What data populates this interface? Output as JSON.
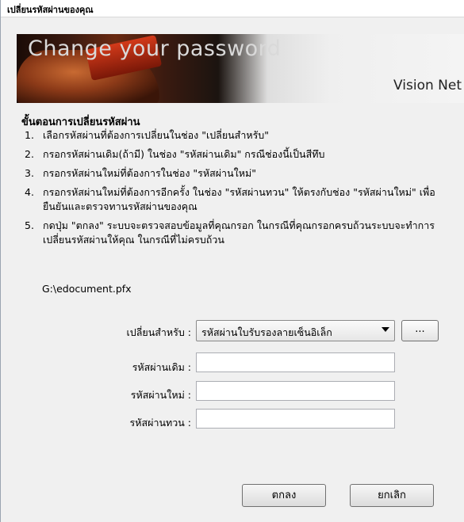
{
  "window": {
    "title": "เปลี่ยนรหัสผ่านของคุณ"
  },
  "banner": {
    "title": "Change your password",
    "logo": "Vision Net"
  },
  "instructions": {
    "heading": "ขั้นตอนการเปลี่ยนรหัสผ่าน",
    "steps": [
      {
        "num": "1.",
        "text": "เลือกรหัสผ่านที่ต้องการเปลี่ยนในช่อง \"เปลี่ยนสำหรับ\""
      },
      {
        "num": "2.",
        "text": "กรอกรหัสผ่านเดิม(ถ้ามี) ในช่อง \"รหัสผ่านเดิม\" กรณีช่องนี้เป็นสีทึบ"
      },
      {
        "num": "3.",
        "text": "กรอกรหัสผ่านใหม่ที่ต้องการในช่อง \"รหัสผ่านใหม่\""
      },
      {
        "num": "4.",
        "text": "กรอกรหัสผ่านใหม่ที่ต้องการอีกครั้ง ในช่อง \"รหัสผ่านทวน\" ให้ตรงกับช่อง \"รหัสผ่านใหม่\" เพื่อยืนยันและตรวจทานรหัสผ่านของคุณ"
      },
      {
        "num": "5.",
        "text": "กดปุ่ม \"ตกลง\" ระบบจะตรวจสอบข้อมูลที่คุณกรอก ในกรณีที่คุณกรอกครบถ้วนระบบจะทำการเปลี่ยนรหัสผ่านให้คุณ ในกรณีที่ไม่ครบถ้วน"
      }
    ],
    "file_path": "G:\\edocument.pfx"
  },
  "form": {
    "change_for_label": "เปลี่ยนสำหรับ :",
    "change_for_value": "รหัสผ่านใบรับรองลายเซ็นอิเล็ก",
    "browse_label": "...",
    "old_password_label": "รหัสผ่านเดิม :",
    "new_password_label": "รหัสผ่านใหม่ :",
    "confirm_password_label": "รหัสผ่านทวน :"
  },
  "buttons": {
    "ok": "ตกลง",
    "cancel": "ยกเลิก"
  }
}
